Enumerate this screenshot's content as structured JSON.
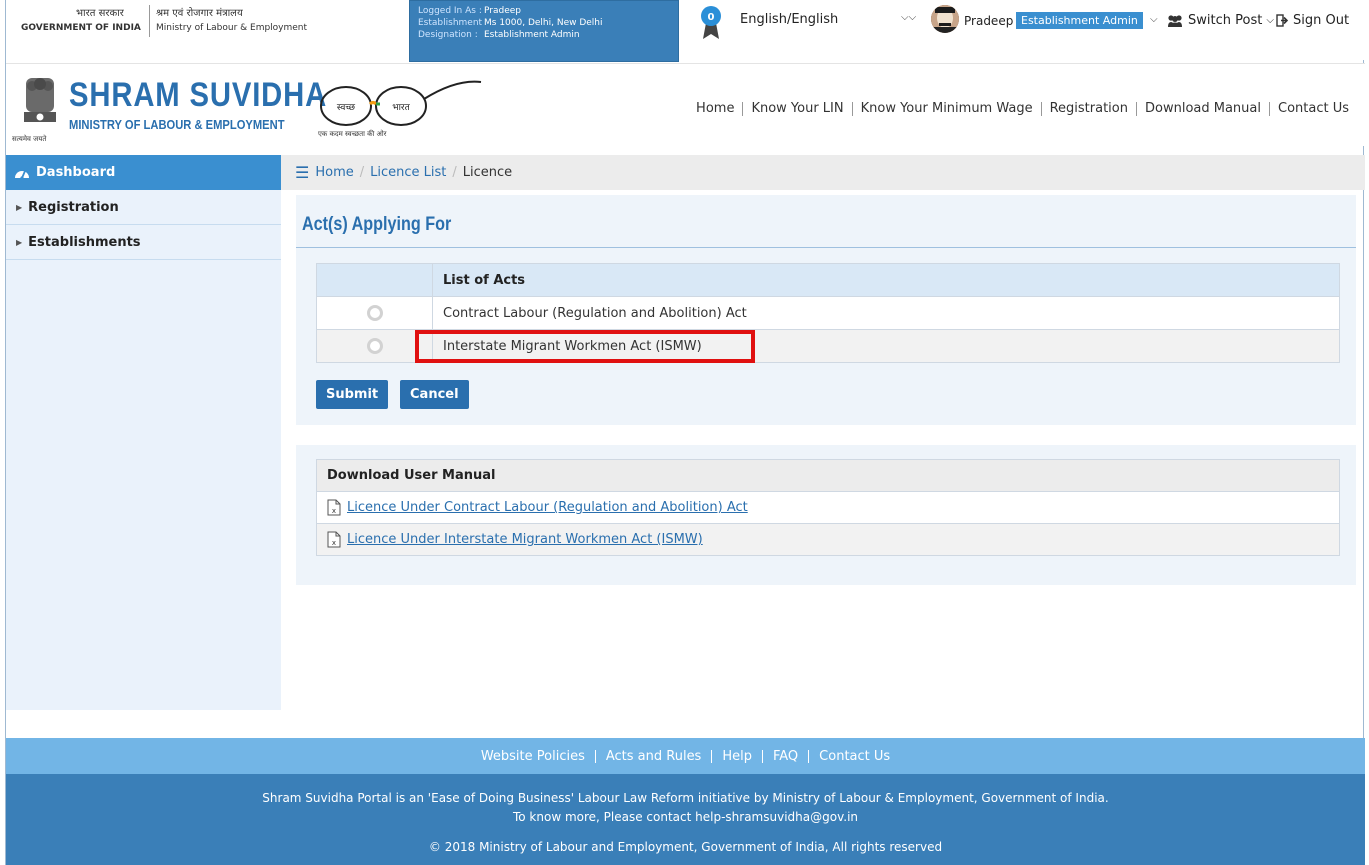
{
  "gov": {
    "hindi": "भारत सरकार",
    "english": "GOVERNMENT OF INDIA",
    "ministry_hindi": "श्रम एवं रोजगार मंत्रालय",
    "ministry_english": "Ministry of Labour & Employment"
  },
  "login": {
    "logged_in_key": "Logged In As :",
    "logged_in_val": "Pradeep",
    "establishment_key": "Establishment :",
    "establishment_val": "Ms 1000, Delhi, New Delhi",
    "designation_key": "Designation :",
    "designation_val": "Establishment Admin"
  },
  "notifications": {
    "count": "0"
  },
  "language": {
    "selected": "English/English"
  },
  "user": {
    "name": "Pradeep",
    "role": "Establishment Admin",
    "switch_post": "Switch Post",
    "sign_out": "Sign Out"
  },
  "brand": {
    "title": "SHRAM SUVIDHA",
    "subtitle": "MINISTRY OF LABOUR & EMPLOYMENT",
    "emblem_motto": "सत्यमेव जयते",
    "swachh_left": "स्वच्छ",
    "swachh_right": "भारत",
    "swachh_tagline": "एक कदम स्वच्छता की ओर"
  },
  "nav": {
    "items": [
      "Home",
      "Know Your LIN",
      "Know Your Minimum Wage",
      "Registration",
      "Download Manual",
      "Contact Us"
    ]
  },
  "sidebar": {
    "header": "Dashboard",
    "items": [
      "Registration",
      "Establishments"
    ]
  },
  "breadcrumb": {
    "home": "Home",
    "licence_list": "Licence List",
    "current": "Licence"
  },
  "acts": {
    "title": "Act(s) Applying For",
    "column_header": "List of Acts",
    "rows": [
      "Contract Labour (Regulation and Abolition) Act",
      "Interstate Migrant Workmen Act (ISMW)"
    ],
    "submit_label": "Submit",
    "cancel_label": "Cancel"
  },
  "manual": {
    "header": "Download User Manual",
    "links": [
      "Licence Under Contract Labour (Regulation and Abolition) Act",
      "Licence Under Interstate Migrant Workmen Act (ISMW)"
    ]
  },
  "footer": {
    "links": [
      "Website Policies",
      "Acts and Rules",
      "Help",
      "FAQ",
      "Contact Us"
    ],
    "line1": "Shram Suvidha Portal is an 'Ease of Doing Business' Labour Law Reform initiative by Ministry of Labour & Employment, Government of India.",
    "line2": "To know more, Please contact help-shramsuvidha@gov.in",
    "copyright": "© 2018 Ministry of Labour and Employment, Government of India, All rights reserved"
  },
  "colors": {
    "primary": "#2a6fae",
    "header_blue": "#3a8fd0",
    "footer_light": "#72b5e6",
    "footer_dark": "#3a7fb8",
    "highlight": "#e01010"
  }
}
